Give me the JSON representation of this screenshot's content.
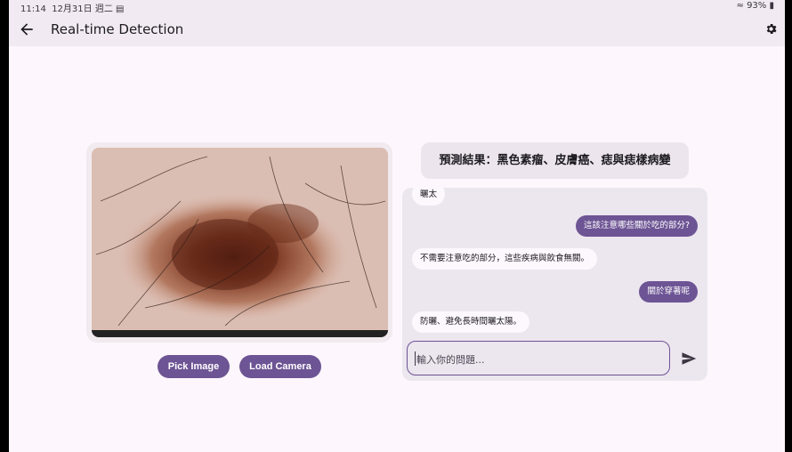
{
  "status_bar": {
    "time": "11:14",
    "date": "12月31日 週二",
    "battery": "93%"
  },
  "app_bar": {
    "title": "Real-time Detection",
    "back_icon": "arrow-back-icon",
    "settings_icon": "gear-icon"
  },
  "actions": {
    "pick_image": "Pick Image",
    "load_camera": "Load Camera"
  },
  "prediction": {
    "text": "預測結果：黑色素瘤、皮膚癌、痣與痣樣病變"
  },
  "chat": {
    "messages": [
      {
        "role": "bot",
        "text": "曬太"
      },
      {
        "role": "user",
        "text": "這該注意哪些關於吃的部分?"
      },
      {
        "role": "bot",
        "text": "不需要注意吃的部分，這些疾病與飲食無關。"
      },
      {
        "role": "user",
        "text": "關於穿著呢"
      },
      {
        "role": "bot",
        "text": "防曬、避免長時間曬太陽。"
      }
    ],
    "input": {
      "value": "",
      "placeholder": "輸入你的問題..."
    }
  },
  "colors": {
    "accent": "#6d5494",
    "surface": "#fdf7fd",
    "bar": "#f1eaf2",
    "chat_bg": "#ece6ef"
  }
}
